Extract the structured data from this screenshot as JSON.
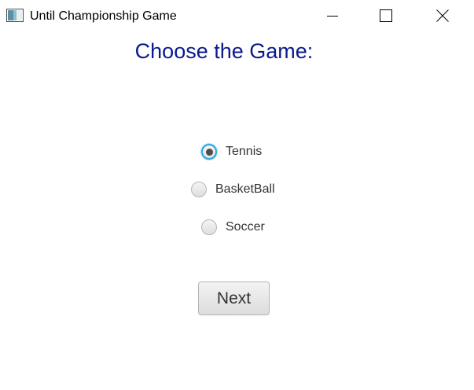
{
  "window": {
    "title": "Until Championship Game",
    "app_icon": "java-app-icon",
    "controls": {
      "minimize_icon": "minimize-icon",
      "maximize_icon": "maximize-icon",
      "close_icon": "close-icon"
    }
  },
  "main": {
    "heading": "Choose the Game:",
    "options": [
      {
        "label": "Tennis",
        "selected": true
      },
      {
        "label": "BasketBall",
        "selected": false
      },
      {
        "label": "Soccer",
        "selected": false
      }
    ],
    "next_label": "Next"
  },
  "colors": {
    "heading": "#0b1a8c",
    "radio_focus_ring": "#2fa8dc",
    "text": "#333333"
  }
}
